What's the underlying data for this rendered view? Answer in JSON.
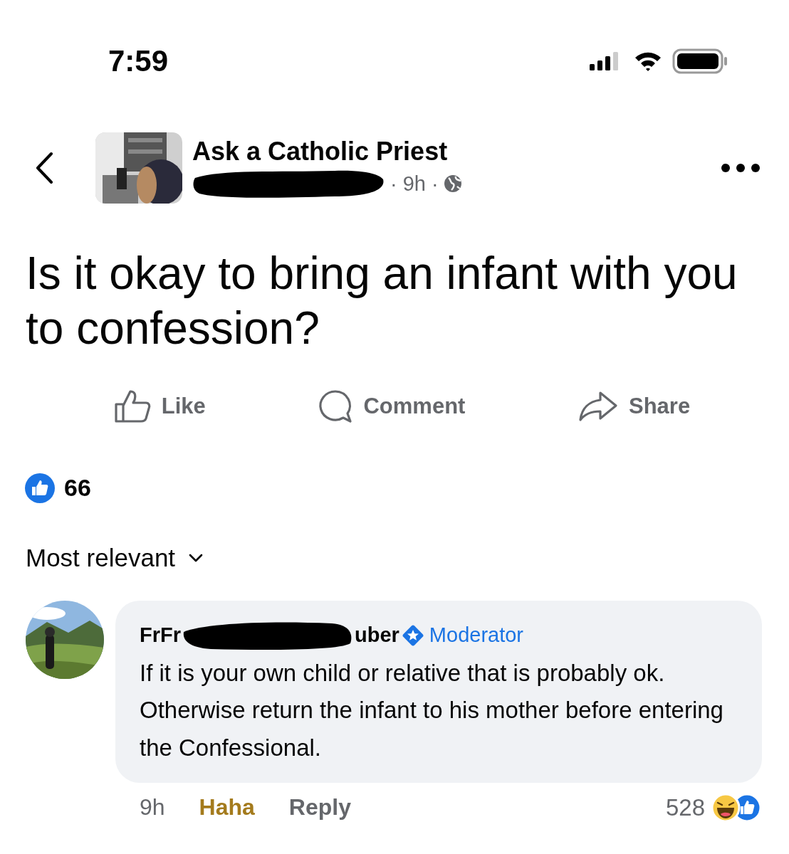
{
  "status_bar": {
    "time": "7:59"
  },
  "header": {
    "group": "Ask a Catholic Priest",
    "meta": "· 9h ·"
  },
  "post": {
    "text": "Is it okay to bring an infant with you to confession?"
  },
  "actions": [
    {
      "label": "Like",
      "kind": "like"
    },
    {
      "label": "Comment",
      "kind": "comment"
    },
    {
      "label": "Share",
      "kind": "share"
    }
  ],
  "reactions": {
    "count": "66"
  },
  "sort": {
    "label": "Most relevant"
  },
  "comment": {
    "author_start": "FrFr",
    "author_end": "uber",
    "badge": "Moderator",
    "text": "If it is your own child or relative that is probably ok. Otherwise return the infant to his mother before entering the Confessional.",
    "time": "9h",
    "reaction_label": "Haha",
    "reply": "Reply",
    "reaction_count": "528"
  }
}
